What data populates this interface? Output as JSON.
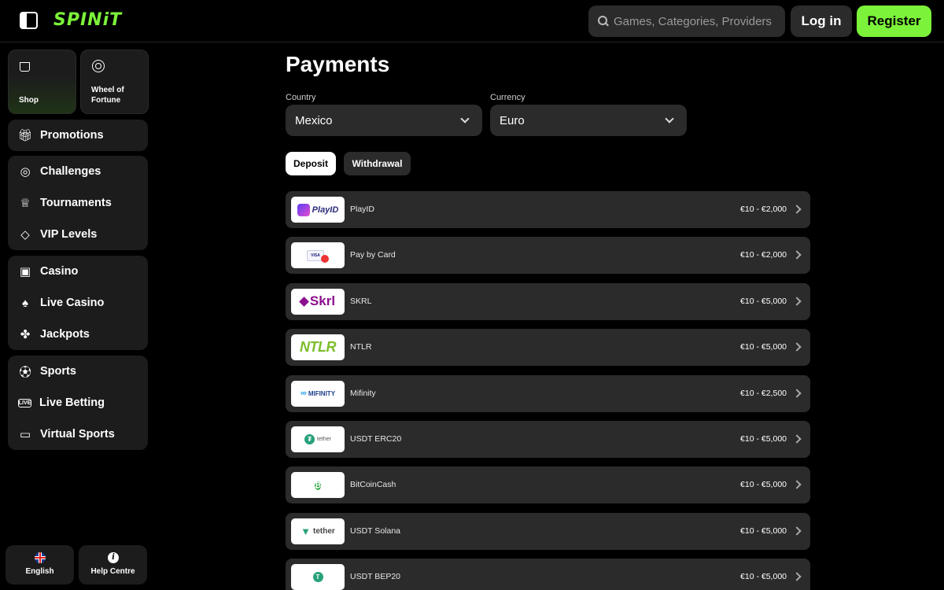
{
  "header": {
    "brand": "SPINiT",
    "search_placeholder": "Games, Categories, Providers",
    "login_label": "Log in",
    "register_label": "Register"
  },
  "sidebar": {
    "tiles": [
      {
        "label": "Shop",
        "icon": "shopping-bag-icon"
      },
      {
        "label": "Wheel of Fortune",
        "icon": "wheel-icon"
      }
    ],
    "groups": [
      [
        {
          "label": "Promotions",
          "icon": "gift-icon"
        }
      ],
      [
        {
          "label": "Challenges",
          "icon": "target-icon"
        },
        {
          "label": "Tournaments",
          "icon": "trophy-icon"
        },
        {
          "label": "VIP Levels",
          "icon": "diamond-icon"
        }
      ],
      [
        {
          "label": "Casino",
          "icon": "slot-machine-icon"
        },
        {
          "label": "Live Casino",
          "icon": "cards-icon"
        },
        {
          "label": "Jackpots",
          "icon": "clover-icon"
        }
      ],
      [
        {
          "label": "Sports",
          "icon": "football-icon"
        },
        {
          "label": "Live Betting",
          "icon": "live-icon"
        },
        {
          "label": "Virtual Sports",
          "icon": "monitor-icon"
        }
      ]
    ],
    "footer": {
      "language_label": "English",
      "help_label": "Help Centre"
    }
  },
  "main": {
    "title": "Payments",
    "country_label": "Country",
    "country_value": "Mexico",
    "currency_label": "Currency",
    "currency_value": "Euro",
    "tabs": [
      {
        "label": "Deposit",
        "active": true
      },
      {
        "label": "Withdrawal",
        "active": false
      }
    ],
    "methods": [
      {
        "name": "PlayID",
        "limit": "€10 - €2,000",
        "logo_text": "PlayID"
      },
      {
        "name": "Pay by Card",
        "limit": "€10 - €2,000",
        "logo_text": "VISA"
      },
      {
        "name": "SKRL",
        "limit": "€10 - €5,000",
        "logo_text": "Skrl"
      },
      {
        "name": "NTLR",
        "limit": "€10 - €5,000",
        "logo_text": "NTLR"
      },
      {
        "name": "Mifinity",
        "limit": "€10 - €2,500",
        "logo_text": "MIFINITY"
      },
      {
        "name": "USDT ERC20",
        "limit": "€10 - €5,000",
        "logo_text": "tether"
      },
      {
        "name": "BitCoinCash",
        "limit": "€10 - €5,000",
        "logo_text": "₿"
      },
      {
        "name": "USDT Solana",
        "limit": "€10 - €5,000",
        "logo_text": "tether"
      },
      {
        "name": "USDT BEP20",
        "limit": "€10 - €5,000",
        "logo_text": "T"
      }
    ]
  },
  "colors": {
    "accent": "#7cf23a",
    "background": "#000000",
    "panel": "#1c1c1c",
    "row": "#2b2b2b"
  }
}
